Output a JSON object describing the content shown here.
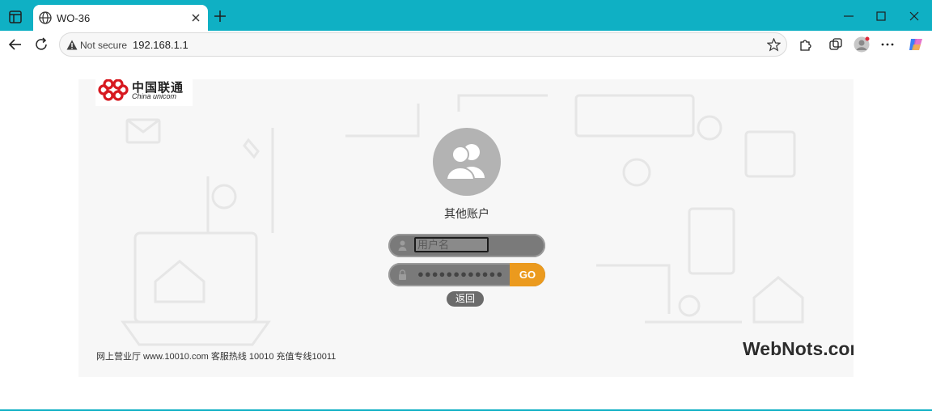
{
  "browser": {
    "tab_title": "WO-36",
    "not_secure_label": "Not secure",
    "url": "192.168.1.1"
  },
  "page": {
    "logo": {
      "chinese": "中国联通",
      "english": "China unicom",
      "color": "#d71920"
    },
    "account_label": "其他账户",
    "username_placeholder": "用户名",
    "password_dots": "●●●●●●●●●●●●",
    "go_label": "GO",
    "back_label": "返回",
    "footer": "网上营业厅 www.10010.com  客服热线  10010  充值专线10011",
    "watermark": "WebNots.com"
  },
  "colors": {
    "browser_frame": "#0fb0c4",
    "go_button": "#eb9a1e",
    "field_bg": "#7a7a7a"
  }
}
